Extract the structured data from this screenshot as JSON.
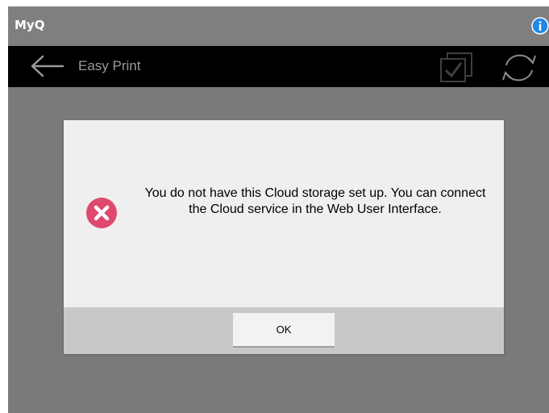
{
  "topbar": {
    "brand": "MyQ",
    "info_icon": "info-icon"
  },
  "navbar": {
    "title": "Easy Print",
    "back_icon": "back-arrow-icon",
    "select_icon": "checkbox-select-icon",
    "refresh_icon": "refresh-icon"
  },
  "dialog": {
    "icon": "error-icon",
    "message": "You do not have this Cloud storage set up. You can connect the Cloud service in the Web User Interface.",
    "ok_label": "OK"
  },
  "colors": {
    "topbar": "#7f7f7f",
    "navbar": "#000000",
    "background": "#7a7a7a",
    "dialog": "#efefef",
    "dialog_footer": "#c8c8c8",
    "error": "#e0486d",
    "info": "#1e88e5"
  }
}
